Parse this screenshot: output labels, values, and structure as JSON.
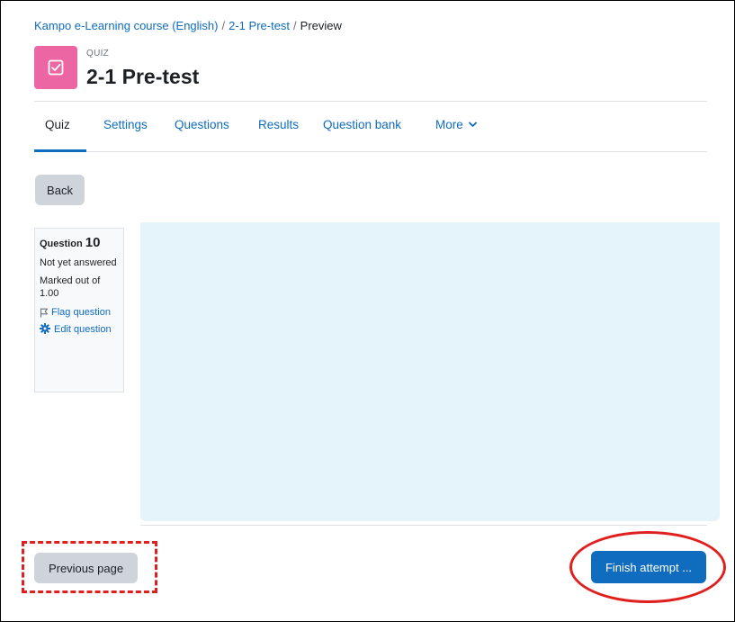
{
  "breadcrumb": {
    "course": "Kampo e-Learning course (English)",
    "separator": "/",
    "quiz": "2-1 Pre-test",
    "current": "Preview"
  },
  "header": {
    "kicker": "QUIZ",
    "title": "2-1 Pre-test",
    "icon": "quiz-checkbox-icon",
    "icon_color": "#eb66a2"
  },
  "tabs": [
    {
      "label": "Quiz",
      "active": true
    },
    {
      "label": "Settings"
    },
    {
      "label": "Questions"
    },
    {
      "label": "Results"
    },
    {
      "label": "Question bank"
    },
    {
      "label": "More"
    }
  ],
  "back_button": "Back",
  "question_info": {
    "label": "Question",
    "number": "10",
    "state": "Not yet answered",
    "grade": "Marked out of 1.00",
    "flag": "Flag question",
    "edit": "Edit question"
  },
  "footer": {
    "previous_button": "Previous page",
    "finish_button": "Finish attempt ..."
  },
  "colors": {
    "accent": "#0f6cbf",
    "annotation": "#e0201f",
    "content_bg": "#e5f3fb"
  }
}
